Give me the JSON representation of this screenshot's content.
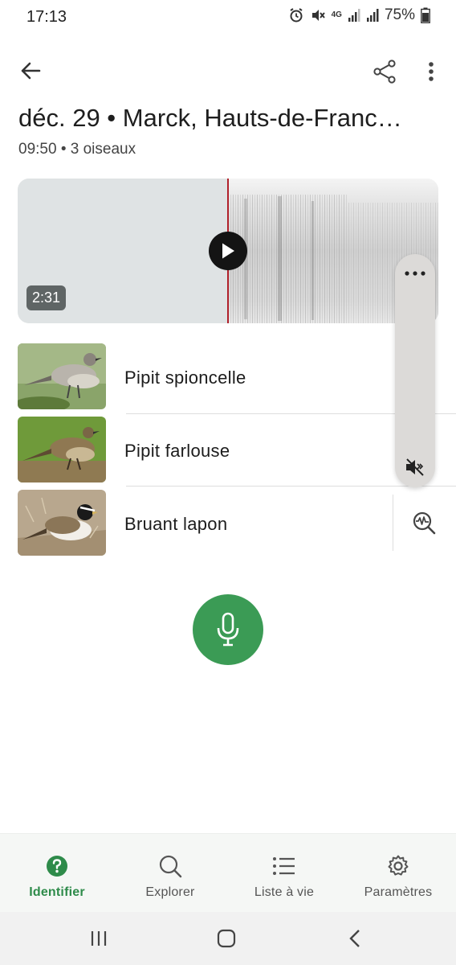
{
  "status_bar": {
    "time": "17:13",
    "network": "4G",
    "battery": "75%"
  },
  "recording": {
    "title": "déc. 29 • Marck, Hauts-de-Franc…",
    "subtitle": "09:50 • 3 oiseaux",
    "duration": "2:31",
    "playback_progress": 0.5
  },
  "species": [
    {
      "name": "Pipit spioncelle"
    },
    {
      "name": "Pipit farlouse"
    },
    {
      "name": "Bruant lapon"
    }
  ],
  "bottom_nav": [
    {
      "label": "Identifier",
      "icon": "help-circle-icon",
      "active": true
    },
    {
      "label": "Explorer",
      "icon": "search-icon",
      "active": false
    },
    {
      "label": "Liste à vie",
      "icon": "list-icon",
      "active": false
    },
    {
      "label": "Paramètres",
      "icon": "gear-icon",
      "active": false
    }
  ],
  "colors": {
    "accent_green": "#3b9b55",
    "nav_active": "#2e8b4a",
    "playhead": "#b0202a"
  }
}
